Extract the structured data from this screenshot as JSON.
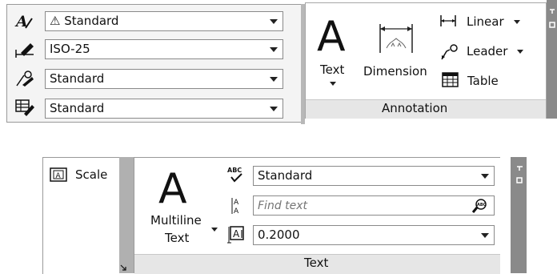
{
  "top_left_panel": {
    "rows": [
      {
        "icon": "text-style-icon",
        "value": "⚠ Standard"
      },
      {
        "icon": "dimension-style-icon",
        "value": "ISO-25"
      },
      {
        "icon": "multileader-style-icon",
        "value": "Standard"
      },
      {
        "icon": "table-style-icon",
        "value": "Standard"
      }
    ]
  },
  "annotation_panel": {
    "text_label": "Text",
    "dimension_label": "Dimension",
    "linear_label": "Linear",
    "leader_label": "Leader",
    "table_label": "Table",
    "panel_title": "Annotation"
  },
  "text_panel": {
    "scale_label": "Scale",
    "multiline_line1": "Multiline",
    "multiline_line2": "Text",
    "style_value": "Standard",
    "find_placeholder": "Find text",
    "height_value": "0.2000",
    "panel_title": "Text"
  }
}
